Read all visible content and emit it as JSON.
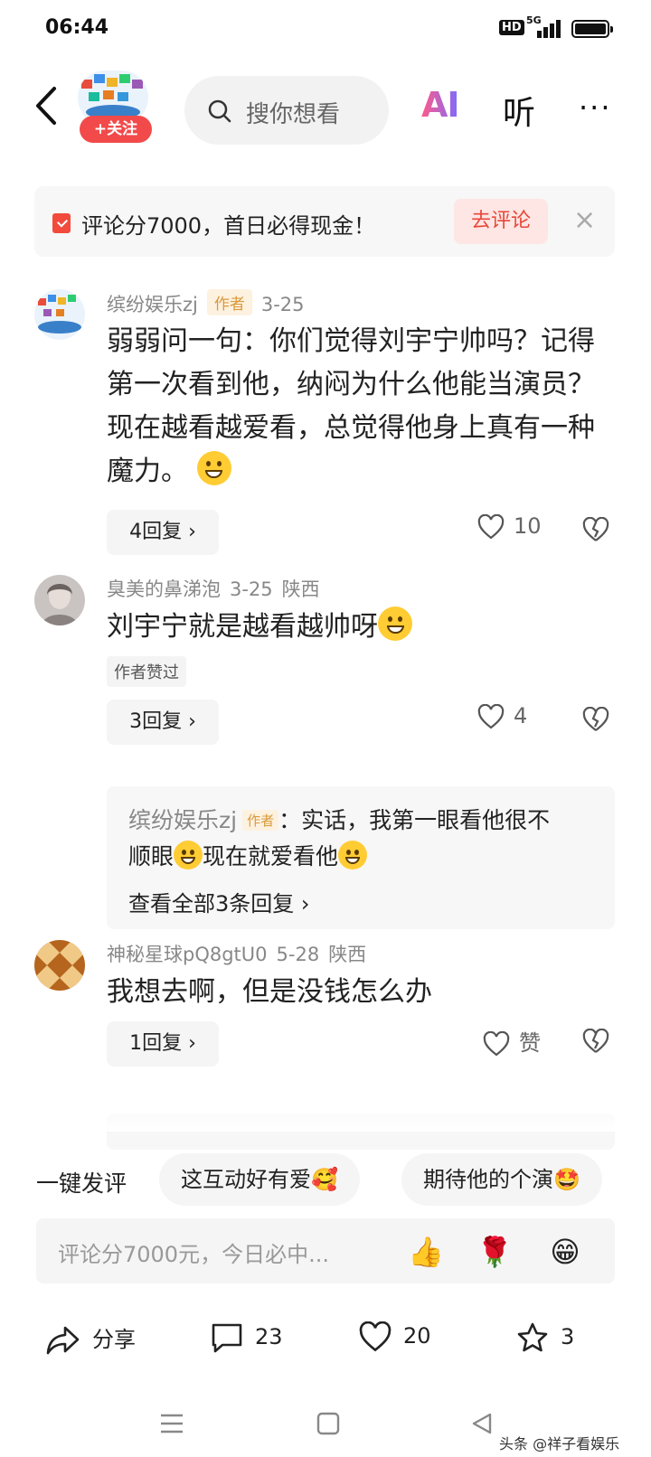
{
  "status_bar": {
    "time": "06:44",
    "hd": "HD",
    "network": "5G"
  },
  "header": {
    "follow_label": "+关注",
    "search_placeholder": "搜你想看",
    "ai_label": "AI",
    "listen_label": "听",
    "more_label": "···"
  },
  "banner": {
    "text": "评论分7000，首日必得现金！",
    "button": "去评论",
    "close": "×"
  },
  "comments": [
    {
      "user": "缤纷娱乐zj",
      "tag": "作者",
      "date": "3-25",
      "location": "",
      "text": "弱弱问一句：你们觉得刘宇宁帅吗？记得第一次看到他，纳闷为什么他能当演员？现在越看越爱看，总觉得他身上真有一种魔力。",
      "replies_label": "4回复 ›",
      "likes": "10"
    },
    {
      "user": "臭美的鼻涕泡",
      "date": "3-25",
      "location": "陕西",
      "text": "刘宇宁就是越看越帅呀",
      "liked_by_author": "作者赞过",
      "replies_label": "3回复 ›",
      "likes": "4",
      "reply_preview": {
        "user": "缤纷娱乐zj",
        "tag": "作者",
        "text_a": "：实话，我第一眼看他很不",
        "text_b": "顺眼",
        "text_c": "现在就爱看他",
        "view_all": "查看全部3条回复 ›"
      }
    },
    {
      "user": "神秘星球pQ8gtU0",
      "date": "5-28",
      "location": "陕西",
      "text": "我想去啊，但是没钱怎么办",
      "replies_label": "1回复 ›",
      "likes": "赞"
    }
  ],
  "quick_comments": {
    "label": "一键发评",
    "chips": [
      "这互动好有爱🥰",
      "期待他的个演🤩"
    ]
  },
  "input": {
    "placeholder": "评论分7000元，今日必中...",
    "emojis": [
      "👍",
      "🌹",
      "😁"
    ]
  },
  "actions": {
    "share": "分享",
    "comments": "23",
    "likes": "20",
    "favorites": "3"
  },
  "watermark": "头条 @祥子看娱乐"
}
